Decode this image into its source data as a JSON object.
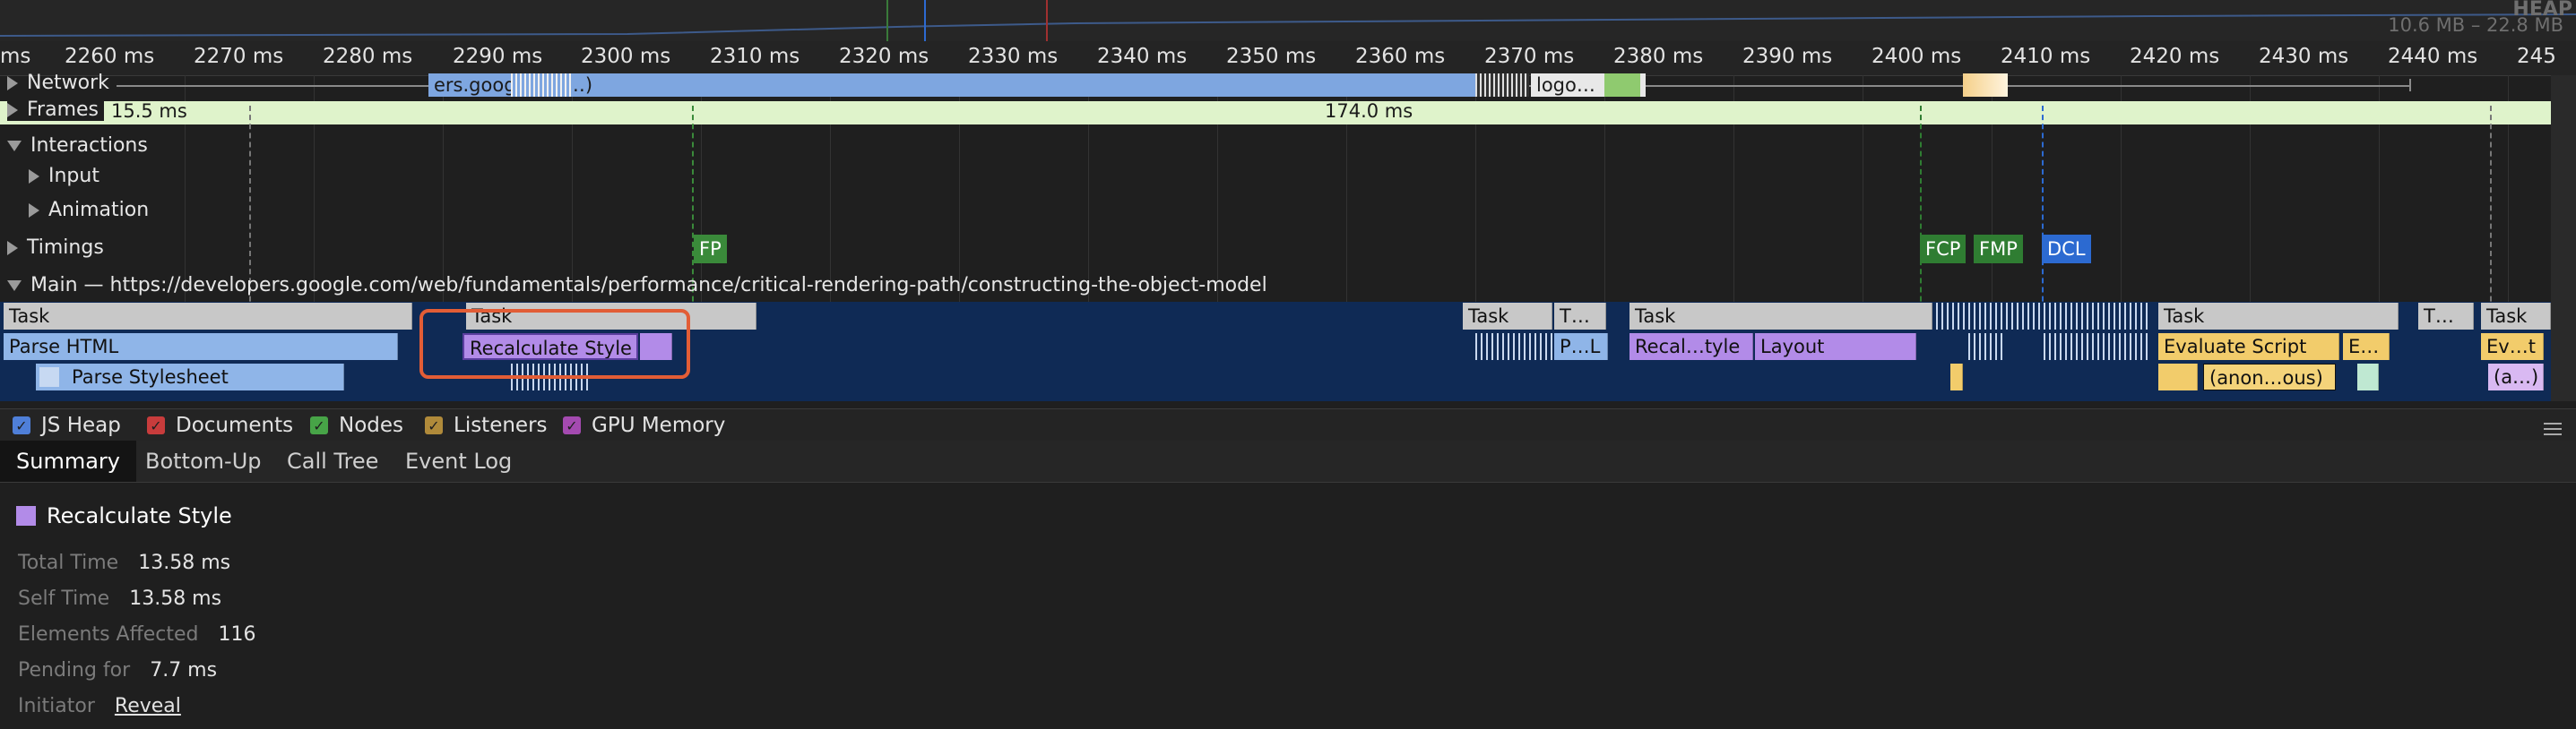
{
  "overview": {
    "heap_label": "HEAP",
    "heap_range": "10.6 MB – 22.8 MB"
  },
  "ruler": {
    "ticks": [
      "ms",
      "2260 ms",
      "2270 ms",
      "2280 ms",
      "2290 ms",
      "2300 ms",
      "2310 ms",
      "2320 ms",
      "2330 ms",
      "2340 ms",
      "2350 ms",
      "2360 ms",
      "2370 ms",
      "2380 ms",
      "2390 ms",
      "2400 ms",
      "2410 ms",
      "2420 ms",
      "2430 ms",
      "2440 ms",
      "245"
    ]
  },
  "tracks": {
    "network": "Network",
    "frames": "Frames",
    "interactions": "Interactions",
    "input": "Input",
    "animation": "Animation",
    "timings": "Timings",
    "main": "Main — https://developers.google.com/web/fundamentals/performance/critical-rendering-path/constructing-the-object-model"
  },
  "network": {
    "bar1": "ers.goog… (m…)",
    "bar2": "logo…"
  },
  "frames": {
    "f1": "15.5 ms",
    "f2": "174.0 ms"
  },
  "timings": {
    "fp": "FP",
    "fcp": "FCP",
    "fmp": "FMP",
    "dcl": "DCL"
  },
  "colors": {
    "fp": "#3a8a3a",
    "fcp": "#2f7d32",
    "fmp": "#2f7d32",
    "dcl": "#2c6ad1",
    "highlight": "#e25d36",
    "recalc": "#b28be8"
  },
  "flame": {
    "row1": [
      "Task",
      "Task",
      "Task",
      "T…",
      "Task",
      "Task",
      "T…",
      "Task"
    ],
    "row2": [
      "Parse HTML",
      "Recalculate Style",
      "P…L",
      "Recal…tyle",
      "Layout",
      "Evaluate Script",
      "E…",
      "Ev…t"
    ],
    "row3": [
      "Parse Stylesheet",
      "(anon…ous)",
      "(a…)"
    ]
  },
  "checkboxes": [
    {
      "label": "JS Heap",
      "color": "#4f7fd8",
      "checked": true
    },
    {
      "label": "Documents",
      "color": "#c83c3c",
      "checked": true
    },
    {
      "label": "Nodes",
      "color": "#47a447",
      "checked": true
    },
    {
      "label": "Listeners",
      "color": "#b08a3a",
      "checked": true
    },
    {
      "label": "GPU Memory",
      "color": "#a44ab0",
      "checked": true
    }
  ],
  "tabs": [
    "Summary",
    "Bottom-Up",
    "Call Tree",
    "Event Log"
  ],
  "summary": {
    "title": "Recalculate Style",
    "rows": [
      {
        "key": "Total Time",
        "value": "13.58 ms"
      },
      {
        "key": "Self Time",
        "value": "13.58 ms"
      },
      {
        "key": "Elements Affected",
        "value": "116"
      },
      {
        "key": "Pending for",
        "value": "7.7 ms"
      },
      {
        "key": "Initiator",
        "value": "Reveal"
      }
    ]
  }
}
